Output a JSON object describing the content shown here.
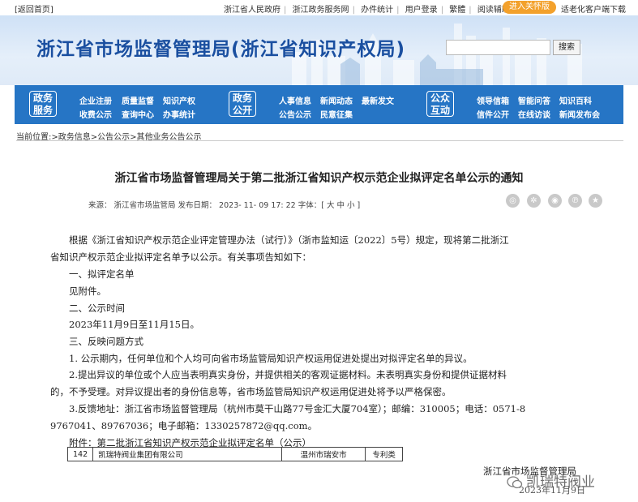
{
  "topbar": {
    "back": "[返回首页]",
    "links": [
      "浙江省人民政府",
      "浙江政务服务网",
      "办件统计",
      "用户登录",
      "繁體",
      "阅读辅助"
    ],
    "care": "进入关怀版",
    "old": "适老化客户端下载"
  },
  "banner": {
    "title": "浙江省市场监督管理局(浙江省知识产权局)",
    "search_button": "搜索"
  },
  "nav": {
    "groups": [
      "政务服务",
      "政务公开",
      "公众互动"
    ],
    "group1": [
      [
        "企业注册",
        "质量监督",
        "知识产权"
      ],
      [
        "收费公示",
        "查询中心",
        "办事统计"
      ]
    ],
    "group2": [
      [
        "人事信息",
        "新闻动态",
        "最新发文"
      ],
      [
        "公告公示",
        "民意征集"
      ]
    ],
    "group3": [
      [
        "领导信箱",
        "智能问答",
        "知识百科"
      ],
      [
        "信件公开",
        "在线访谈",
        "新闻发布会"
      ]
    ]
  },
  "breadcrumb": "当前位置:>政务信息>公告公示>其他业务公告公示",
  "article": {
    "title": "浙江省市场监督管理局关于第二批浙江省知识产权示范企业拟评定名单公示的通知",
    "meta": "来源： 浙江省市场监管局 发布日期： 2023- 11- 09 17: 22 字体：[ 大 中 小 ]",
    "lines": [
      "根据《浙江省知识产权示范企业评定管理办法（试行）》（浙市监知运〔2022〕5号）规定，现将第二批浙江",
      "省知识产权示范企业拟评定名单予以公示。有关事项告知如下：",
      "一、拟评定名单",
      "见附件。",
      "二、公示时间",
      "2023年11月9日至11月15日。",
      "三、反映问题方式",
      "1. 公示期内，任何单位和个人均可向省市场监管局知识产权运用促进处提出对拟评定名单的异议。",
      "2.提出异议的单位或个人应当表明真实身份，并提供相关的客观证据材料。未表明真实身份和提供证据材料",
      "的，不予受理。对异议提出者的身份信息等，省市场监管局知识产权运用促进处将予以严格保密。",
      "3.反馈地址：浙江省市场监督管理局（杭州市莫干山路77号金汇大厦704室）；邮编：310005；电话：0571-8",
      "9767041、89767036；电子邮箱：1330257872@qq.com。",
      "附件：第二批浙江省知识产权示范企业拟评定名单（公示）"
    ],
    "table_row": [
      "142",
      "凯瑞特阀业集团有限公司",
      "温州市瑞安市",
      "专利类"
    ],
    "signature": "浙江省市场监督管理局",
    "date": "2023年11月9日"
  },
  "watermark": "凯瑞特阀业"
}
